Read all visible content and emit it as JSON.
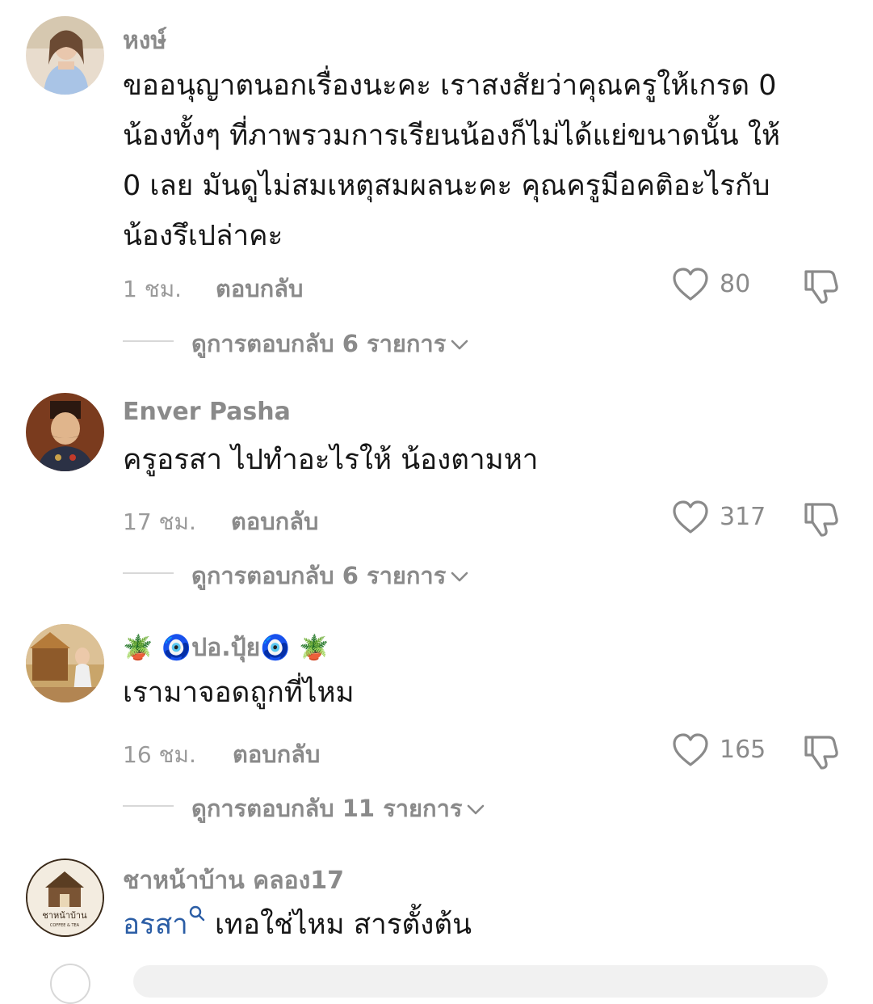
{
  "comments": [
    {
      "username": "หงษ์",
      "body_lines": [
        "ขออนุญาตนอกเรื่องนะคะ เราสงสัยว่าคุณครูให้เกรด 0",
        "น้องทั้งๆ ที่ภาพรวมการเรียนน้องก็ไม่ได้แย่ขนาดนั้น ให้",
        "0 เลย มันดูไม่สมเหตุสมผลนะคะ คุณครูมีอคติอะไรกับ",
        "น้องรึเปล่าคะ"
      ],
      "time": "1 ชม.",
      "reply_label": "ตอบกลับ",
      "likes": "80",
      "replies_label": "ดูการตอบกลับ 6 รายการ",
      "avatar_color": "#d9c8b4"
    },
    {
      "username": "Enver Pasha",
      "body_lines": [
        "ครูอรสา ไปทำอะไรให้ น้องตามหา"
      ],
      "time": "17 ชม.",
      "reply_label": "ตอบกลับ",
      "likes": "317",
      "replies_label": "ดูการตอบกลับ 6 รายการ",
      "avatar_color": "#8a4a2a"
    },
    {
      "username": "🪴 🧿ปอ.ปุ้ย🧿 🪴",
      "body_lines": [
        "เรามาจอดถูกที่ไหม"
      ],
      "time": "16 ชม.",
      "reply_label": "ตอบกลับ",
      "likes": "165",
      "replies_label": "ดูการตอบกลับ 11 รายการ",
      "avatar_color": "#c9a56a"
    },
    {
      "username": "ชาหน้าบ้าน คลอง17",
      "mention": "อรสา",
      "body_rest": " เทอใช่ไหม สารตั้งต้น",
      "avatar_text": "ชาหน้าบ้าน",
      "avatar_subtext": "COFFEE & TEA",
      "avatar_color": "#f3ece0"
    }
  ],
  "colors": {
    "username": "#8a8a8a",
    "body": "#161616",
    "meta": "#9a9a9a",
    "mention": "#2b5da5",
    "divider": "#d8d8d8"
  },
  "icons": {
    "like": "heart-outline-icon",
    "dislike": "thumbs-down-outline-icon",
    "expand": "chevron-down-icon",
    "mention": "search-icon"
  }
}
